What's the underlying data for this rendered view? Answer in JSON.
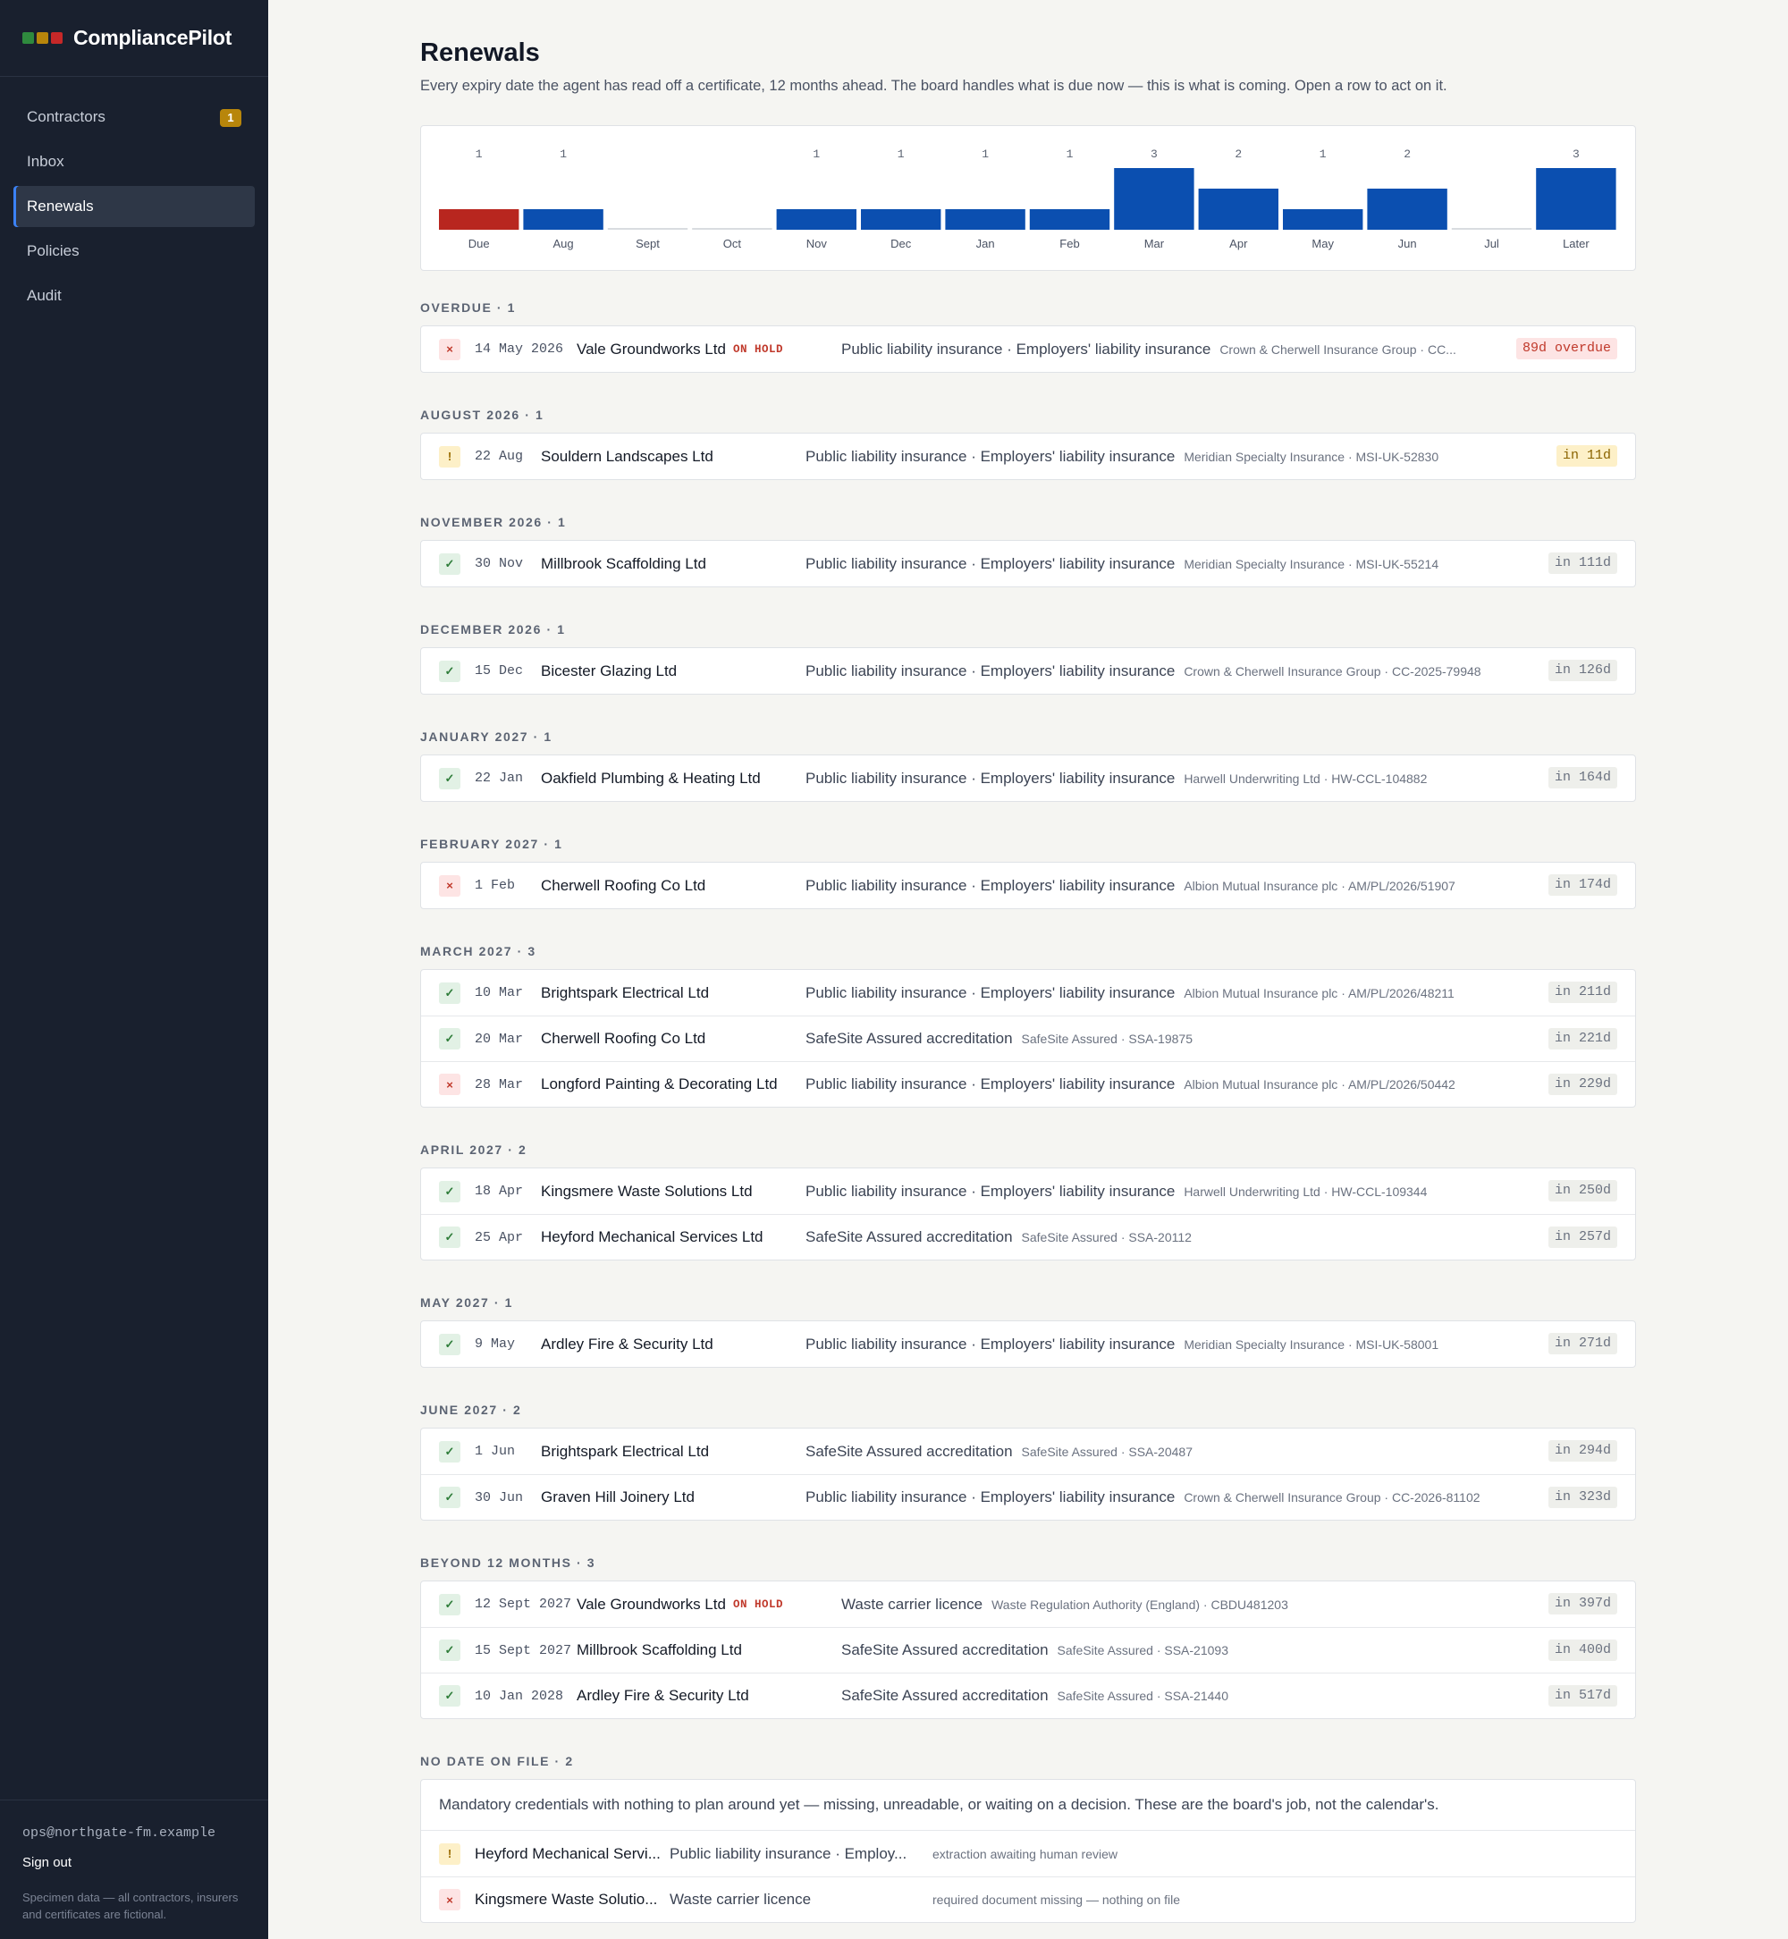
{
  "app": {
    "name": "CompliancePilot",
    "logo_colors": [
      "#2f8a3e",
      "#b8860b",
      "#c62828"
    ]
  },
  "sidebar": {
    "items": [
      {
        "label": "Contractors",
        "badge": "1",
        "active": false
      },
      {
        "label": "Inbox",
        "badge": "",
        "active": false
      },
      {
        "label": "Renewals",
        "badge": "",
        "active": true
      },
      {
        "label": "Policies",
        "badge": "",
        "active": false
      },
      {
        "label": "Audit",
        "badge": "",
        "active": false
      }
    ],
    "user_email": "ops@northgate-fm.example",
    "sign_out": "Sign out",
    "footnote": "Specimen data — all contractors, insurers and certificates are fictional."
  },
  "page": {
    "title": "Renewals",
    "subtitle": "Every expiry date the agent has read off a certificate, 12 months ahead. The board handles what is due now — this is what is coming. Open a row to act on it."
  },
  "chart_data": {
    "type": "bar",
    "categories": [
      "Due",
      "Aug",
      "Sept",
      "Oct",
      "Nov",
      "Dec",
      "Jan",
      "Feb",
      "Mar",
      "Apr",
      "May",
      "Jun",
      "Jul",
      "Later"
    ],
    "values": [
      1,
      1,
      0,
      0,
      1,
      1,
      1,
      1,
      3,
      2,
      1,
      2,
      0,
      3
    ],
    "value_labels": [
      "1",
      "1",
      "",
      "",
      "1",
      "1",
      "1",
      "1",
      "3",
      "2",
      "1",
      "2",
      "",
      "3"
    ],
    "colors": {
      "due": "#b8261f",
      "upcoming": "#0b4fb0",
      "empty": "#d9dce0"
    },
    "ylim": [
      0,
      3
    ]
  },
  "sections": [
    {
      "label": "OVERDUE · 1",
      "rows": [
        {
          "status": "bad",
          "date": "14 May 2026",
          "contractor": "Vale Groundworks Ltd",
          "hold": "ON HOLD",
          "doc": "Public liability insurance · Employers' liability insurance",
          "insurer": "Crown & Cherwell Insurance Group · CC...",
          "due": "89d overdue",
          "due_kind": "over"
        }
      ]
    },
    {
      "label": "AUGUST 2026 · 1",
      "rows": [
        {
          "status": "warn",
          "date": "22 Aug",
          "contractor": "Souldern Landscapes Ltd",
          "hold": "",
          "doc": "Public liability insurance · Employers' liability insurance",
          "insurer": "Meridian Specialty Insurance · MSI-UK-52830",
          "due": "in 11d",
          "due_kind": "soon"
        }
      ]
    },
    {
      "label": "NOVEMBER 2026 · 1",
      "rows": [
        {
          "status": "ok",
          "date": "30 Nov",
          "contractor": "Millbrook Scaffolding Ltd",
          "hold": "",
          "doc": "Public liability insurance · Employers' liability insurance",
          "insurer": "Meridian Specialty Insurance · MSI-UK-55214",
          "due": "in 111d",
          "due_kind": "neutral"
        }
      ]
    },
    {
      "label": "DECEMBER 2026 · 1",
      "rows": [
        {
          "status": "ok",
          "date": "15 Dec",
          "contractor": "Bicester Glazing Ltd",
          "hold": "",
          "doc": "Public liability insurance · Employers' liability insurance",
          "insurer": "Crown & Cherwell Insurance Group · CC-2025-79948",
          "due": "in 126d",
          "due_kind": "neutral"
        }
      ]
    },
    {
      "label": "JANUARY 2027 · 1",
      "rows": [
        {
          "status": "ok",
          "date": "22 Jan",
          "contractor": "Oakfield Plumbing & Heating Ltd",
          "hold": "",
          "doc": "Public liability insurance · Employers' liability insurance",
          "insurer": "Harwell Underwriting Ltd · HW-CCL-104882",
          "due": "in 164d",
          "due_kind": "neutral"
        }
      ]
    },
    {
      "label": "FEBRUARY 2027 · 1",
      "rows": [
        {
          "status": "bad",
          "date": "1 Feb",
          "contractor": "Cherwell Roofing Co Ltd",
          "hold": "",
          "doc": "Public liability insurance · Employers' liability insurance",
          "insurer": "Albion Mutual Insurance plc · AM/PL/2026/51907",
          "due": "in 174d",
          "due_kind": "neutral"
        }
      ]
    },
    {
      "label": "MARCH 2027 · 3",
      "rows": [
        {
          "status": "ok",
          "date": "10 Mar",
          "contractor": "Brightspark Electrical Ltd",
          "hold": "",
          "doc": "Public liability insurance · Employers' liability insurance",
          "insurer": "Albion Mutual Insurance plc · AM/PL/2026/48211",
          "due": "in 211d",
          "due_kind": "neutral"
        },
        {
          "status": "ok",
          "date": "20 Mar",
          "contractor": "Cherwell Roofing Co Ltd",
          "hold": "",
          "doc": "SafeSite Assured accreditation",
          "insurer": "SafeSite Assured · SSA-19875",
          "due": "in 221d",
          "due_kind": "neutral"
        },
        {
          "status": "bad",
          "date": "28 Mar",
          "contractor": "Longford Painting & Decorating Ltd",
          "hold": "",
          "doc": "Public liability insurance · Employers' liability insurance",
          "insurer": "Albion Mutual Insurance plc · AM/PL/2026/50442",
          "due": "in 229d",
          "due_kind": "neutral"
        }
      ]
    },
    {
      "label": "APRIL 2027 · 2",
      "rows": [
        {
          "status": "ok",
          "date": "18 Apr",
          "contractor": "Kingsmere Waste Solutions Ltd",
          "hold": "",
          "doc": "Public liability insurance · Employers' liability insurance",
          "insurer": "Harwell Underwriting Ltd · HW-CCL-109344",
          "due": "in 250d",
          "due_kind": "neutral"
        },
        {
          "status": "ok",
          "date": "25 Apr",
          "contractor": "Heyford Mechanical Services Ltd",
          "hold": "",
          "doc": "SafeSite Assured accreditation",
          "insurer": "SafeSite Assured · SSA-20112",
          "due": "in 257d",
          "due_kind": "neutral"
        }
      ]
    },
    {
      "label": "MAY 2027 · 1",
      "rows": [
        {
          "status": "ok",
          "date": "9 May",
          "contractor": "Ardley Fire & Security Ltd",
          "hold": "",
          "doc": "Public liability insurance · Employers' liability insurance",
          "insurer": "Meridian Specialty Insurance · MSI-UK-58001",
          "due": "in 271d",
          "due_kind": "neutral"
        }
      ]
    },
    {
      "label": "JUNE 2027 · 2",
      "rows": [
        {
          "status": "ok",
          "date": "1 Jun",
          "contractor": "Brightspark Electrical Ltd",
          "hold": "",
          "doc": "SafeSite Assured accreditation",
          "insurer": "SafeSite Assured · SSA-20487",
          "due": "in 294d",
          "due_kind": "neutral"
        },
        {
          "status": "ok",
          "date": "30 Jun",
          "contractor": "Graven Hill Joinery Ltd",
          "hold": "",
          "doc": "Public liability insurance · Employers' liability insurance",
          "insurer": "Crown & Cherwell Insurance Group · CC-2026-81102",
          "due": "in 323d",
          "due_kind": "neutral"
        }
      ]
    },
    {
      "label": "BEYOND 12 MONTHS · 3",
      "rows": [
        {
          "status": "ok",
          "date": "12 Sept 2027",
          "contractor": "Vale Groundworks Ltd",
          "hold": "ON HOLD",
          "doc": "Waste carrier licence",
          "insurer": "Waste Regulation Authority (England) · CBDU481203",
          "due": "in 397d",
          "due_kind": "neutral"
        },
        {
          "status": "ok",
          "date": "15 Sept 2027",
          "contractor": "Millbrook Scaffolding Ltd",
          "hold": "",
          "doc": "SafeSite Assured accreditation",
          "insurer": "SafeSite Assured · SSA-21093",
          "due": "in 400d",
          "due_kind": "neutral"
        },
        {
          "status": "ok",
          "date": "10 Jan 2028",
          "contractor": "Ardley Fire & Security Ltd",
          "hold": "",
          "doc": "SafeSite Assured accreditation",
          "insurer": "SafeSite Assured · SSA-21440",
          "due": "in 517d",
          "due_kind": "neutral"
        }
      ]
    }
  ],
  "no_date": {
    "label": "NO DATE ON FILE · 2",
    "intro": "Mandatory credentials with nothing to plan around yet — missing, unreadable, or waiting on a decision. These are the board's job, not the calendar's.",
    "rows": [
      {
        "status": "warn",
        "contractor": "Heyford Mechanical Servi...",
        "doc": "Public liability insurance · Employ...",
        "reason": "extraction awaiting human review"
      },
      {
        "status": "bad",
        "contractor": "Kingsmere Waste Solutio...",
        "doc": "Waste carrier licence",
        "reason": "required document missing — nothing on file"
      }
    ]
  },
  "status_icons": {
    "ok": "✓",
    "bad": "×",
    "warn": "!"
  }
}
